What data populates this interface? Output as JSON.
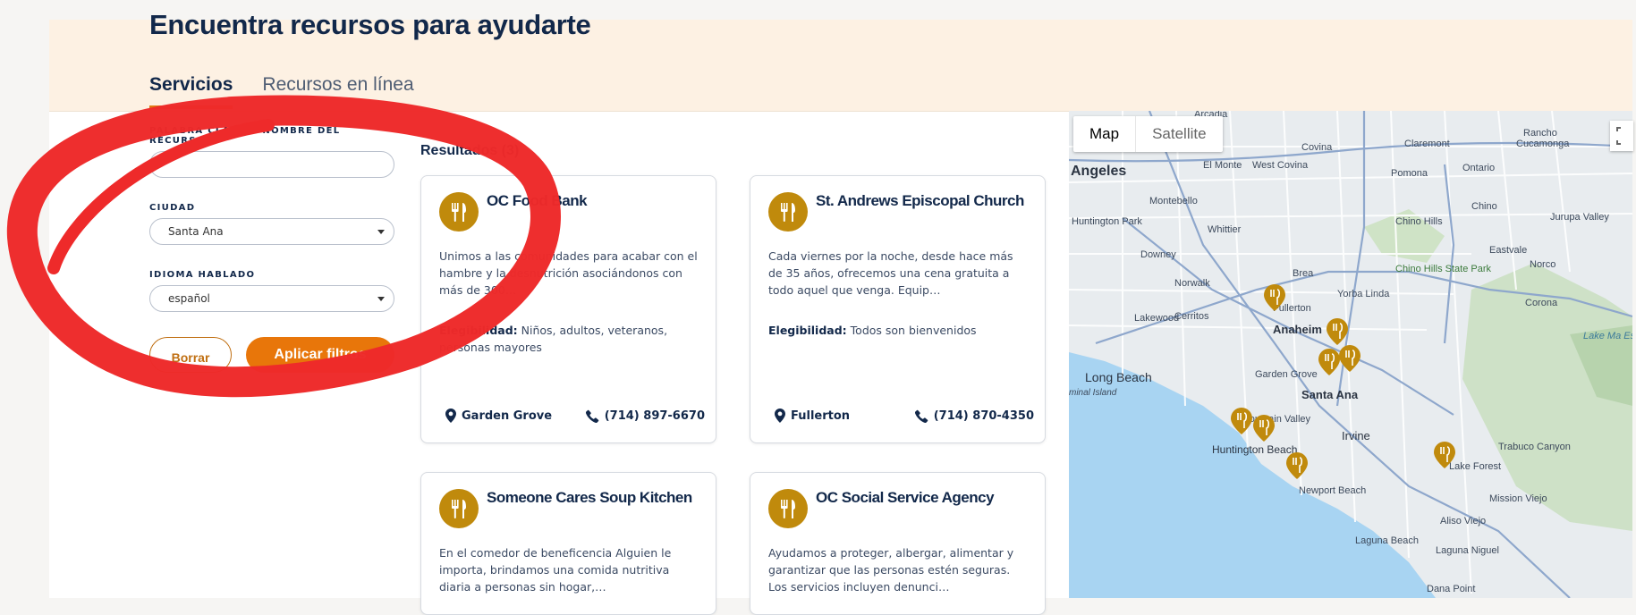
{
  "header": {
    "title": "Encuentra recursos para ayudarte"
  },
  "tabs": [
    {
      "label": "Servicios",
      "active": true
    },
    {
      "label": "Recursos en línea",
      "active": false
    }
  ],
  "filters": {
    "keyword_label": "PALABRA CLAVE O NOMBRE DEL RECURSO",
    "keyword_value": "",
    "city_label": "CIUDAD",
    "city_value": "Santa Ana",
    "language_label": "IDIOMA HABLADO",
    "language_value": "español",
    "clear_label": "Borrar",
    "apply_label": "Aplicar filtros"
  },
  "results": {
    "title": "Resultados (3)",
    "cards": [
      {
        "name": "OC Food Bank",
        "description": "Unimos a las comunidades para acabar con el hambre y la desnutrición asociándonos con más de 300…",
        "eligibility_label": "Elegibilidad:",
        "eligibility": "Niños, adultos, veteranos, personas mayores",
        "city": "Garden Grove",
        "phone": "(714) 897-6670"
      },
      {
        "name": "St. Andrews Episcopal Church",
        "description": "Cada viernes por la noche, desde hace más de 35 años, ofrecemos una cena gratuita a todo aquel que venga. Equip…",
        "eligibility_label": "Elegibilidad:",
        "eligibility": "Todos son bienvenidos",
        "city": "Fullerton",
        "phone": "(714) 870-4350"
      },
      {
        "name": "Someone Cares Soup Kitchen",
        "description": "En el comedor de beneficencia Alguien le importa, brindamos una comida nutritiva diaria a personas sin hogar,…"
      },
      {
        "name": "OC Social Service Agency",
        "description": "Ayudamos a proteger, albergar, alimentar y garantizar que las personas estén seguras. Los servicios incluyen denunci…"
      }
    ]
  },
  "map": {
    "toggle_map": "Map",
    "toggle_satellite": "Satellite",
    "labels": {
      "arcadia": "Arcadia",
      "covina": "Covina",
      "claremont": "Claremont",
      "rancho": "Rancho",
      "cucamonga": "Cucamonga",
      "angeles": "Angeles",
      "el_monte": "El Monte",
      "west_covina": "West Covina",
      "pomona": "Pomona",
      "ontario": "Ontario",
      "montebello": "Montebello",
      "chino": "Chino",
      "huntington_park": "Huntington Park",
      "whittier": "Whittier",
      "chino_hills": "Chino Hills",
      "jurupa_valley": "Jurupa Valley",
      "eastvale": "Eastvale",
      "downey": "Downey",
      "norco": "Norco",
      "chino_hills_sp": "Chino Hills State Park",
      "brea": "Brea",
      "norwalk": "Norwalk",
      "yorba_linda": "Yorba Linda",
      "fullerton": "Fullerton",
      "corona": "Corona",
      "lakewood": "Lakewood",
      "cerritos": "Cerritos",
      "anaheim": "Anaheim",
      "long_beach": "Long Beach",
      "garden_grove": "Garden Grove",
      "santa_ana": "Santa Ana",
      "fountain_valley": "Fountain Valley",
      "irvine": "Irvine",
      "huntington_beach": "Huntington Beach",
      "trabuco_canyon": "Trabuco Canyon",
      "lake_forest": "Lake Forest",
      "newport_beach": "Newport Beach",
      "mission_viejo": "Mission Viejo",
      "aliso_viejo": "Aliso Viejo",
      "laguna_beach": "Laguna Beach",
      "laguna_niguel": "Laguna Niguel",
      "dana_point": "Dana Point",
      "lake_mathews": "Lake Ma Este Mount Reser",
      "terminal_island": "minal Island"
    }
  },
  "colors": {
    "accent": "#e8760a",
    "navy": "#12284a",
    "pin": "#c08a0c",
    "annotation": "#ee2a2a"
  }
}
